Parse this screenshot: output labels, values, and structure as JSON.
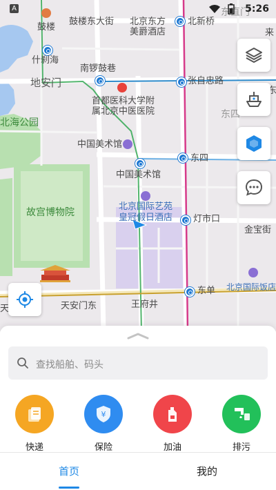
{
  "status_bar": {
    "time": "5:26",
    "gps_letter": "A"
  },
  "map": {
    "labels": {
      "gulou": "鼓楼",
      "gulou_east": "鼓楼东大街",
      "dongfang_hotel": "北京东方",
      "meijue": "美爵酒店",
      "beixinqiao": "北新桥",
      "dongzhimen": "东直门",
      "lai": "来",
      "shichahai": "什刹海",
      "nanluoguxiang": "南锣鼓巷",
      "dianmen": "地安门",
      "zhangzizhong": "张自忠路",
      "hospital_1": "首都医科大学附",
      "hospital_2": "属北京中医医院",
      "dongsi_gray": "东四",
      "dong_right": "东",
      "beihai": "北海公园",
      "art_museum": "中国美术馆",
      "art_museum_station": "中国美术馆",
      "dongsi_station": "东四",
      "palace_museum": "故宫博物院",
      "hotel_1": "北京国际艺苑",
      "hotel_2": "皇冠假日酒店",
      "dengshikou": "灯市口",
      "jinbaojie": "金宝街",
      "wangfujing": "王府井",
      "dongdan": "东单",
      "tiananmen_east": "天安门东",
      "tian": "天",
      "intl_hotel": "北京国际饭店"
    }
  },
  "controls": {
    "layers": "layers-icon",
    "ship": "ship-icon",
    "hexagon": "hexagon-icon",
    "chat": "chat-icon",
    "locate": "locate-icon"
  },
  "search": {
    "placeholder": "查找船舶、码头"
  },
  "services": [
    {
      "label": "快递",
      "icon": "courier-icon",
      "color": "#f5a623"
    },
    {
      "label": "保险",
      "icon": "insurance-icon",
      "color": "#2f8cf0"
    },
    {
      "label": "加油",
      "icon": "fuel-icon",
      "color": "#f0454a"
    },
    {
      "label": "排污",
      "icon": "sewage-icon",
      "color": "#22c05a"
    }
  ],
  "tabs": [
    {
      "label": "首页",
      "active": true
    },
    {
      "label": "我的",
      "active": false
    }
  ]
}
